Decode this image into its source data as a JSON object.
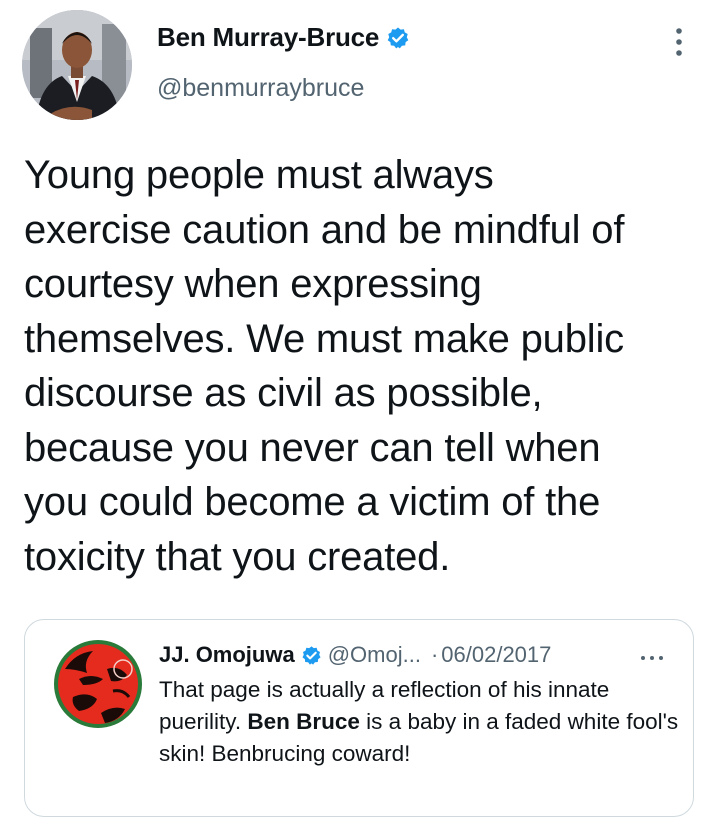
{
  "author": {
    "name": "Ben Murray-Bruce",
    "handle": "@benmurraybruce",
    "verified_icon": "verified-badge-icon",
    "more_icon": "more-vertical-icon"
  },
  "tweet": {
    "text": "Young people must always\nexercise caution and be mindful of\ncourtesy when expressing\nthemselves. We must make public\ndiscourse as civil as possible,\nbecause you never can tell when\nyou could become a victim of the\ntoxicity that you created."
  },
  "quoted_tweet": {
    "name": "JJ. Omojuwa",
    "handle": "@Omoj...",
    "separator": "·",
    "date": "06/02/2017",
    "more_icon": "more-horizontal-icon",
    "text_part1": "That page is actually a reflection of his innate puerility. ",
    "text_bold": "Ben Bruce",
    "text_part2": " is a baby in a faded white fool's skin! Benbrucing coward!"
  },
  "colors": {
    "primary_text": "#0f1419",
    "secondary_text": "#536471",
    "verified_blue": "#1d9bf0",
    "border": "#cfd9de"
  }
}
